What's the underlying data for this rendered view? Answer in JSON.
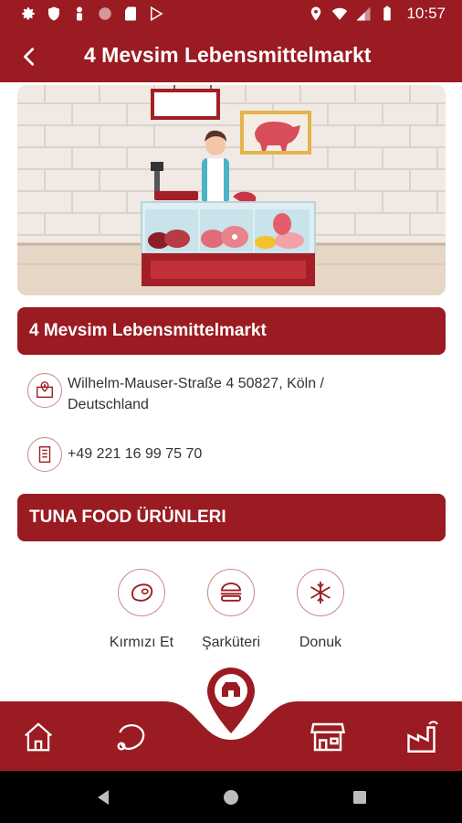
{
  "status_bar": {
    "time": "10:57",
    "icons": [
      "settings-icon",
      "shield-icon",
      "person-icon",
      "record-icon",
      "sd-card-icon",
      "play-store-icon",
      "location-icon",
      "wifi-icon",
      "signal-icon",
      "battery-icon"
    ]
  },
  "app_bar": {
    "title": "4 Mevsim Lebensmittelmarkt",
    "back_icon": "back-arrow-icon"
  },
  "store": {
    "name": "4 Mevsim Lebensmittelmarkt",
    "address_line1": "Wilhelm-Mauser-Straße 4 50827, Köln /",
    "address_line2": "Deutschland",
    "phone": "+49 221 16 99 75 70",
    "address_icon": "map-location-icon",
    "phone_icon": "phone-building-icon"
  },
  "products_section": {
    "title": "TUNA FOOD ÜRÜNLERI",
    "categories": [
      {
        "label": "Kırmızı Et",
        "icon": "steak-icon"
      },
      {
        "label": "Şarküteri",
        "icon": "burger-icon"
      },
      {
        "label": "Donuk",
        "icon": "snowflake-icon"
      }
    ]
  },
  "bottom_nav": {
    "items": [
      "home-icon",
      "meat-icon",
      "store-locator-icon",
      "market-icon",
      "factory-icon"
    ]
  },
  "system_nav": [
    "back-triangle-icon",
    "home-circle-icon",
    "recents-square-icon"
  ],
  "colors": {
    "brand_red": "#9b1b22",
    "icon_border": "#c9888b",
    "text": "#333333"
  }
}
